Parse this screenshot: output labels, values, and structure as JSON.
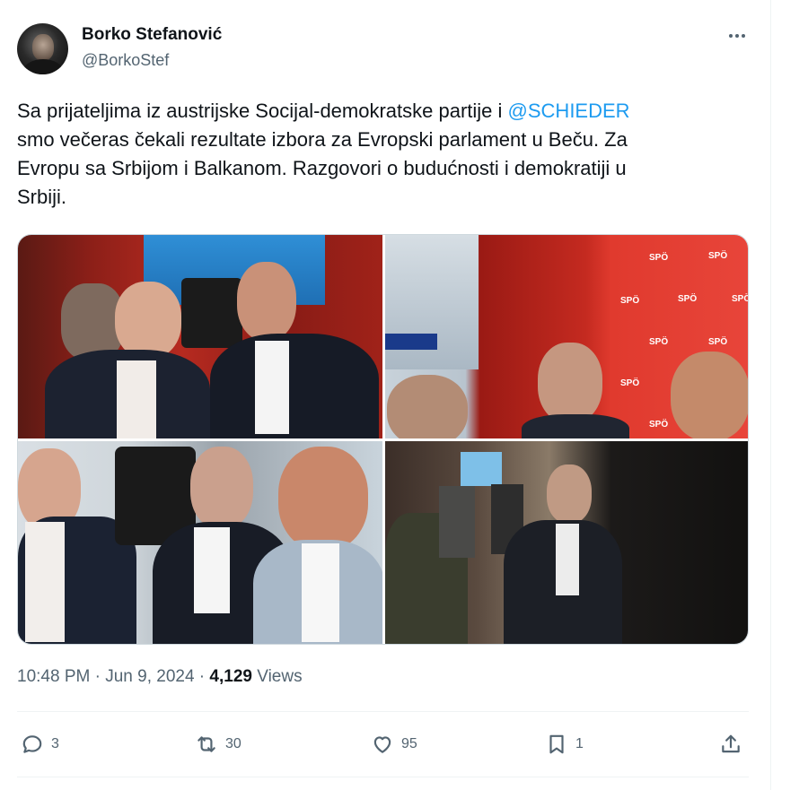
{
  "author": {
    "name": "Borko Stefanović",
    "handle": "@BorkoStef"
  },
  "tweet": {
    "lines": [
      {
        "before": "Sa prijateljima iz austrijske Socijal-demokratske partije i ",
        "mention": "@SCHIEDER"
      },
      {
        "text": "smo večeras čekali rezultate izbora za Evropski parlament u Beču. Za"
      },
      {
        "text": "Evropu sa Srbijom i Balkanom. Razgovori o budućnosti i demokratiji u"
      },
      {
        "text": "Srbiji."
      }
    ]
  },
  "media": {
    "spo_label": "SPÖ"
  },
  "meta": {
    "time": "10:48 PM",
    "separator": " · ",
    "date": "Jun 9, 2024",
    "separator2": " · ",
    "views_count": "4,129",
    "views_label": " Views"
  },
  "actions": {
    "replies": "3",
    "reposts": "30",
    "likes": "95",
    "bookmarks": "1"
  },
  "icons": [
    "more-icon",
    "reply-icon",
    "repost-icon",
    "like-icon",
    "bookmark-icon",
    "share-icon"
  ],
  "colors": {
    "link": "#1d9bf0",
    "secondary_text": "#536471",
    "primary_text": "#0f1419"
  }
}
